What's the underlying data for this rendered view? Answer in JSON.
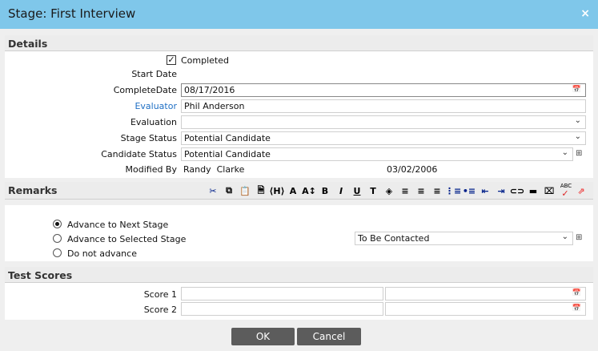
{
  "title": "Stage: First Interview",
  "close_label": "×",
  "details": {
    "heading": "Details",
    "completed_label": "Completed",
    "completed": true,
    "start_date_label": "Start Date",
    "complete_date_label": "CompleteDate",
    "complete_date": "08/17/2016",
    "evaluator_label": "Evaluator",
    "evaluator": "Phil Anderson",
    "evaluation_label": "Evaluation",
    "evaluation": "",
    "stage_status_label": "Stage Status",
    "stage_status": "Potential Candidate",
    "candidate_status_label": "Candidate Status",
    "candidate_status": "Potential Candidate",
    "modified_by_label": "Modified By",
    "modified_by": "Randy  Clarke",
    "modified_date": "03/02/2006"
  },
  "remarks": {
    "heading": "Remarks",
    "toolbar": [
      {
        "name": "cut-icon",
        "glyph": "✂"
      },
      {
        "name": "copy-icon",
        "glyph": "⧉"
      },
      {
        "name": "paste-icon",
        "glyph": "📋"
      },
      {
        "name": "paste-text-icon",
        "glyph": "🗎"
      },
      {
        "name": "heading-icon",
        "glyph": "⟨H⟩"
      },
      {
        "name": "font-icon",
        "glyph": "A"
      },
      {
        "name": "font-size-icon",
        "glyph": "A↕"
      },
      {
        "name": "bold-icon",
        "glyph": "B"
      },
      {
        "name": "italic-icon",
        "glyph": "I"
      },
      {
        "name": "underline-icon",
        "glyph": "U"
      },
      {
        "name": "text-color-icon",
        "glyph": "T"
      },
      {
        "name": "background-color-icon",
        "glyph": "◈"
      },
      {
        "name": "align-left-icon",
        "glyph": "≡"
      },
      {
        "name": "align-center-icon",
        "glyph": "≡"
      },
      {
        "name": "align-right-icon",
        "glyph": "≡"
      },
      {
        "name": "ordered-list-icon",
        "glyph": "⋮≡"
      },
      {
        "name": "unordered-list-icon",
        "glyph": "•≡"
      },
      {
        "name": "outdent-icon",
        "glyph": "⇤"
      },
      {
        "name": "indent-icon",
        "glyph": "⇥"
      },
      {
        "name": "link-icon",
        "glyph": "⊂⊃"
      },
      {
        "name": "horizontal-rule-icon",
        "glyph": "▬"
      },
      {
        "name": "clear-format-icon",
        "glyph": "⌧"
      },
      {
        "name": "spellcheck-icon",
        "glyph": "✓"
      },
      {
        "name": "maximize-icon",
        "glyph": "⇗"
      }
    ],
    "spell_abc": "ABC",
    "options": [
      {
        "label": "Advance to Next Stage",
        "selected": true
      },
      {
        "label": "Advance to Selected Stage",
        "selected": false
      },
      {
        "label": "Do not advance",
        "selected": false
      }
    ],
    "selected_stage": "To Be Contacted"
  },
  "test_scores": {
    "heading": "Test Scores",
    "rows": [
      {
        "label": "Score 1",
        "value": "",
        "date": ""
      },
      {
        "label": "Score 2",
        "value": "",
        "date": ""
      }
    ]
  },
  "buttons": {
    "ok": "OK",
    "cancel": "Cancel"
  },
  "icons": {
    "calendar": "📅",
    "chevron": "⌄",
    "grid": "⊞",
    "check": "✓"
  }
}
